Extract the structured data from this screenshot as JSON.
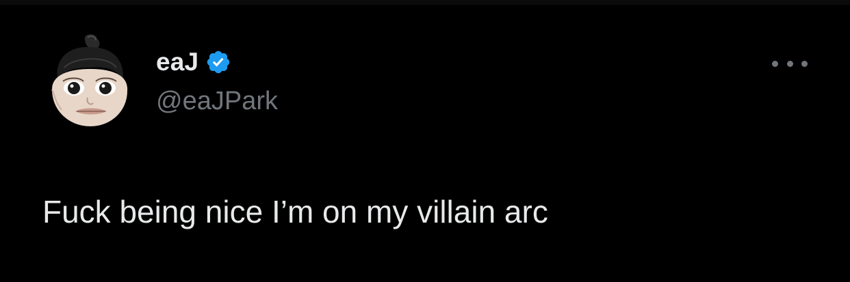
{
  "author": {
    "display_name": "eaJ",
    "handle": "@eaJPark",
    "verified_icon": "verified-badge-icon",
    "avatar_icon": "avatar-image"
  },
  "tweet": {
    "text": "Fuck being nice I’m on my villain arc"
  },
  "actions": {
    "more_icon": "more-horizontal-icon"
  },
  "colors": {
    "background": "#000000",
    "primary_text": "#e7e9ea",
    "secondary_text": "#71767b",
    "verified": "#1d9bf0"
  }
}
